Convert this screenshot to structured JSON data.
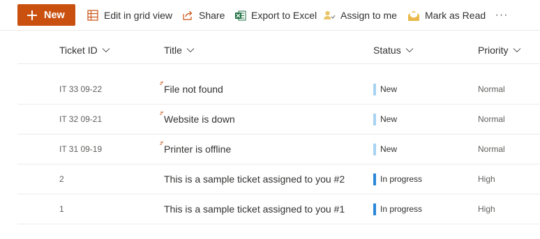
{
  "command_bar": {
    "new_label": "New",
    "edit_grid_label": "Edit in grid view",
    "share_label": "Share",
    "export_label": "Export to Excel",
    "assign_label": "Assign to me",
    "mark_read_label": "Mark as Read",
    "more_label": "···"
  },
  "colors": {
    "accent": "#ca5010",
    "status_new": "#a9d3f2",
    "status_in_progress": "#2b88d8",
    "excel_green": "#1d6f42"
  },
  "columns": {
    "ticket_id": "Ticket ID",
    "title": "Title",
    "status": "Status",
    "priority": "Priority"
  },
  "rows": [
    {
      "ticket_id": "IT 33 09-22",
      "title": "File not found",
      "status": "New",
      "priority": "Normal"
    },
    {
      "ticket_id": "IT 32 09-21",
      "title": "Website is down",
      "status": "New",
      "priority": "Normal"
    },
    {
      "ticket_id": "IT 31 09-19",
      "title": "Printer is offline",
      "status": "New",
      "priority": "Normal"
    },
    {
      "ticket_id": "2",
      "title": "This is a sample ticket assigned to you #2",
      "status": "In progress",
      "priority": "High"
    },
    {
      "ticket_id": "1",
      "title": "This is a sample ticket assigned to you #1",
      "status": "In progress",
      "priority": "High"
    }
  ]
}
